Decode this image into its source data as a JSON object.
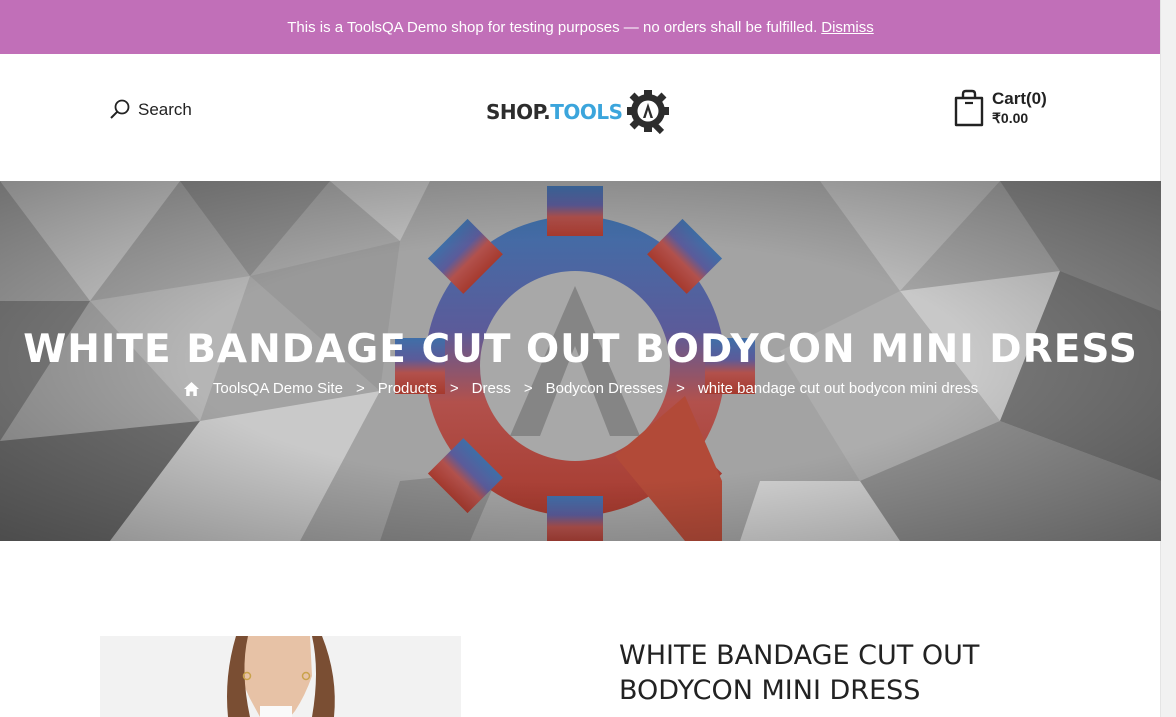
{
  "notice": {
    "message": "This is a ToolsQA Demo shop for testing purposes — no orders shall be fulfilled.",
    "dismiss_label": "Dismiss"
  },
  "header": {
    "search_label": "Search",
    "logo": {
      "part1": "SHOP.",
      "part2": "TOOLS"
    },
    "cart": {
      "label": "Cart(0)",
      "total": "₹0.00"
    }
  },
  "hero": {
    "title": "WHITE BANDAGE CUT OUT BODYCON MINI DRESS",
    "breadcrumb": [
      {
        "label": "ToolsQA Demo Site"
      },
      {
        "label": "Products"
      },
      {
        "label": "Dress"
      },
      {
        "label": "Bodycon Dresses"
      },
      {
        "label": "white bandage cut out bodycon mini dress"
      }
    ],
    "separator": ">"
  },
  "product": {
    "title": "WHITE BANDAGE CUT OUT BODYCON MINI DRESS"
  },
  "colors": {
    "notice_bg": "#c16fb8",
    "logo_tools": "#3ba5dc",
    "hero_bg": "#9a9a9a"
  },
  "icons": [
    "search-icon",
    "shop-logo-gear-icon",
    "shopping-bag-icon",
    "home-icon"
  ]
}
